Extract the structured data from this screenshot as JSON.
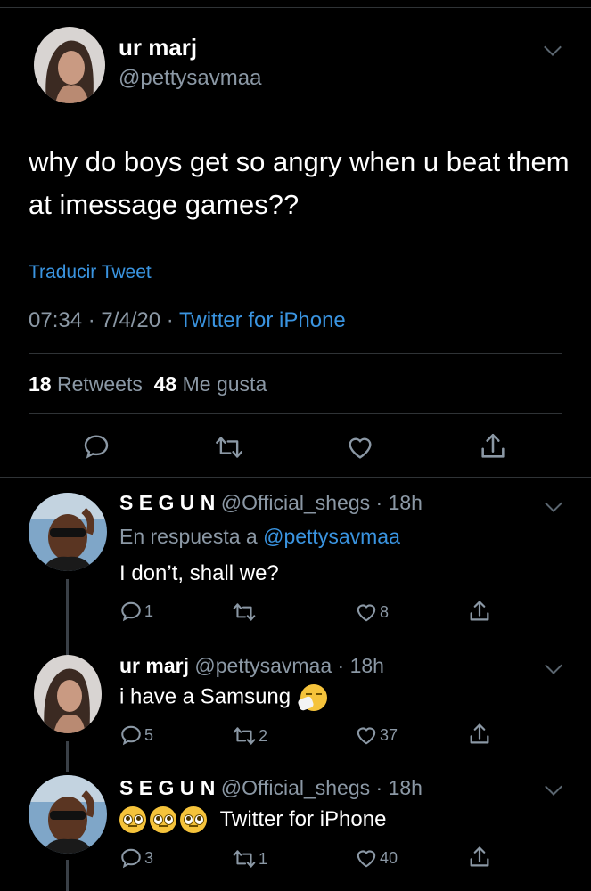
{
  "main_tweet": {
    "display_name": "ur marj",
    "handle": "@pettysavmaa",
    "text": "why do boys get so angry when u beat them at imessage games??",
    "translate_label": "Traducir Tweet",
    "time": "07:34",
    "date": "7/4/20",
    "client": "Twitter for iPhone",
    "retweets_count": "18",
    "retweets_label": "Retweets",
    "likes_count": "48",
    "likes_label": "Me gusta"
  },
  "replies": [
    {
      "display_name": "S E G U N",
      "handle": "@Official_shegs",
      "age": "18h",
      "reply_to_label": "En respuesta a",
      "reply_to_handle": "@pettysavmaa",
      "text": "I don’t, shall we?",
      "reply_count": "1",
      "retweet_count": "",
      "like_count": "8"
    },
    {
      "display_name": "ur marj",
      "handle": "@pettysavmaa",
      "age": "18h",
      "text": "i have a Samsung",
      "emoji": "sneezing-face-emoji",
      "reply_count": "5",
      "retweet_count": "2",
      "like_count": "37"
    },
    {
      "display_name": "S E G U N",
      "handle": "@Official_shegs",
      "age": "18h",
      "emojis": [
        "eye-roll-emoji",
        "eye-roll-emoji",
        "eye-roll-emoji"
      ],
      "text": "Twitter for iPhone",
      "reply_count": "3",
      "retweet_count": "1",
      "like_count": "40"
    }
  ],
  "colors": {
    "background": "#000000",
    "link": "#3a94e0",
    "muted": "#8b98a5",
    "divider": "#2f3336"
  }
}
